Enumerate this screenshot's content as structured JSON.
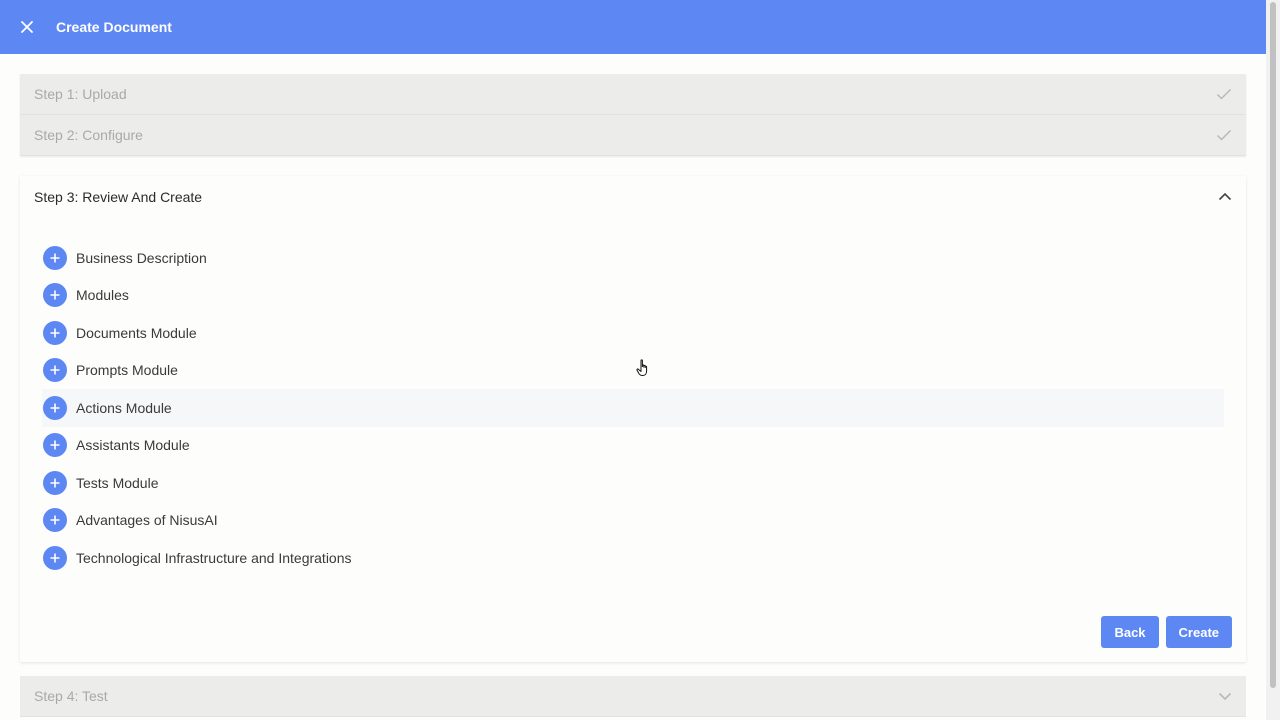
{
  "header": {
    "title": "Create Document",
    "close_icon": "close-icon"
  },
  "steps": {
    "step1": {
      "label": "Step 1: Upload",
      "status_icon": "check-icon"
    },
    "step2": {
      "label": "Step 2: Configure",
      "status_icon": "check-icon"
    },
    "step3": {
      "label": "Step 3: Review And Create",
      "status_icon": "chevron-up-icon"
    },
    "step4": {
      "label": "Step 4: Test",
      "status_icon": "chevron-down-icon"
    }
  },
  "sections": [
    {
      "label": "Business Description"
    },
    {
      "label": "Modules"
    },
    {
      "label": "Documents Module"
    },
    {
      "label": "Prompts Module"
    },
    {
      "label": "Actions Module"
    },
    {
      "label": "Assistants Module"
    },
    {
      "label": "Tests Module"
    },
    {
      "label": "Advantages of NisusAI"
    },
    {
      "label": "Technological Infrastructure and Integrations"
    }
  ],
  "actions": {
    "back_label": "Back",
    "create_label": "Create"
  },
  "colors": {
    "accent": "#5d87f3",
    "muted_text": "#a9a9a9",
    "collapsed_bg": "#ececeb"
  }
}
